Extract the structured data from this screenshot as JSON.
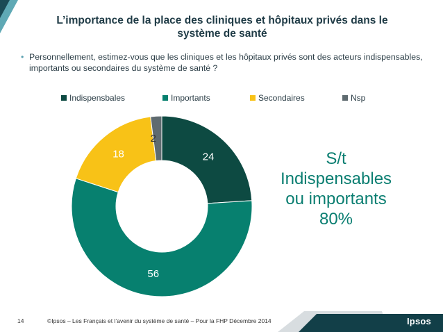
{
  "slide": {
    "title_line1": "L’importance de la place des cliniques et hôpitaux privés dans le",
    "title_line2": "système de santé",
    "question_bullet": "•",
    "question": "Personnellement, estimez-vous que les cliniques et les hôpitaux privés sont des acteurs indispensables, importants ou secondaires du système de santé ?",
    "summary_lines": [
      "S/t",
      "Indispensables",
      "ou importants",
      "80%"
    ],
    "page_number": "14",
    "copyright": "©Ipsos – Les Français et l’avenir du système de santé – Pour la FHP  Décembre 2014",
    "logo": "Ipsos"
  },
  "colors": {
    "title": "#1f3b46",
    "summary": "#0a7e71",
    "corner_dark": "#1b4a55",
    "corner_light": "#5fa9b5",
    "footer_band": "#123f48"
  },
  "chart_data": {
    "type": "pie",
    "donut": true,
    "legend_position": "top",
    "categories": [
      "Indispensbales",
      "Importants",
      "Secondaires",
      "Nsp"
    ],
    "values": [
      24,
      56,
      18,
      2
    ],
    "colors": [
      "#0d4a42",
      "#07806f",
      "#f8c217",
      "#5f6b70"
    ],
    "label_colors": [
      "#ffffff",
      "#ffffff",
      "#ffffff",
      "#333333"
    ]
  }
}
